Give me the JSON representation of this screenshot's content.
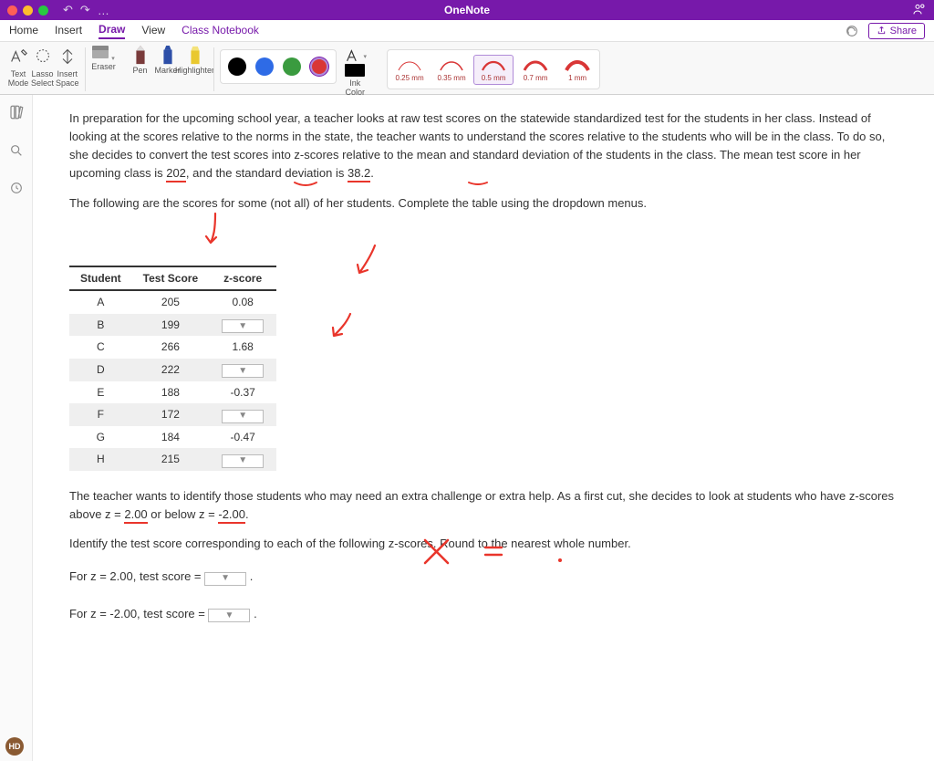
{
  "app": {
    "title": "OneNote"
  },
  "qat": {
    "undo": "↶",
    "redo": "↷",
    "more": "…"
  },
  "tabs": {
    "home": "Home",
    "insert": "Insert",
    "draw": "Draw",
    "view": "View",
    "class_notebook": "Class Notebook",
    "share": "Share"
  },
  "ribbon": {
    "text_mode": "Text\nMode",
    "lasso": "Lasso\nSelect",
    "insert_space": "Insert\nSpace",
    "eraser": "Eraser",
    "pen": "Pen",
    "marker": "Marker",
    "highlighter": "Highlighter",
    "ink_color": "Ink\nColor",
    "strokes": {
      "s025": "0.25 mm",
      "s035": "0.35 mm",
      "s05": "0.5 mm",
      "s07": "0.7 mm",
      "s1": "1 mm"
    }
  },
  "content": {
    "p1": "In preparation for the upcoming school year, a teacher looks at raw test scores on the statewide standardized test for the students in her class. Instead of looking at the scores relative to the norms in the state, the teacher wants to understand the scores relative to the students who will be in the class. To do so, she decides to convert the test scores into z-scores relative to the mean and standard deviation of the students in the class. The mean test score in her upcoming class is ",
    "mean": "202",
    "p1b": ", and the standard deviation is ",
    "sd": "38.2",
    "p1c": ".",
    "p2": "The following are the scores for some (not all) of her students. Complete the table using the dropdown menus.",
    "table": {
      "h_student": "Student",
      "h_score": "Test Score",
      "h_z": "z-score",
      "rows": [
        {
          "s": "A",
          "t": "205",
          "z": "0.08"
        },
        {
          "s": "B",
          "t": "199",
          "z": ""
        },
        {
          "s": "C",
          "t": "266",
          "z": "1.68"
        },
        {
          "s": "D",
          "t": "222",
          "z": ""
        },
        {
          "s": "E",
          "t": "188",
          "z": "-0.37"
        },
        {
          "s": "F",
          "t": "172",
          "z": ""
        },
        {
          "s": "G",
          "t": "184",
          "z": "-0.47"
        },
        {
          "s": "H",
          "t": "215",
          "z": ""
        }
      ]
    },
    "p3a": "The teacher wants to identify those students who may need an extra challenge or extra help. As a first cut, she decides to look at students who have z-scores above z = ",
    "z_hi": "2.00",
    "p3b": " or below z = ",
    "z_lo": "-2.00",
    "p3c": ".",
    "p4": "Identify the test score corresponding to each of the following z-scores. Round to the nearest whole number.",
    "p5a": "For z = 2.00, test score = ",
    "p5b": " .",
    "p6a": "For z = -2.00, test score = ",
    "p6b": " ."
  },
  "avatar": "HD"
}
